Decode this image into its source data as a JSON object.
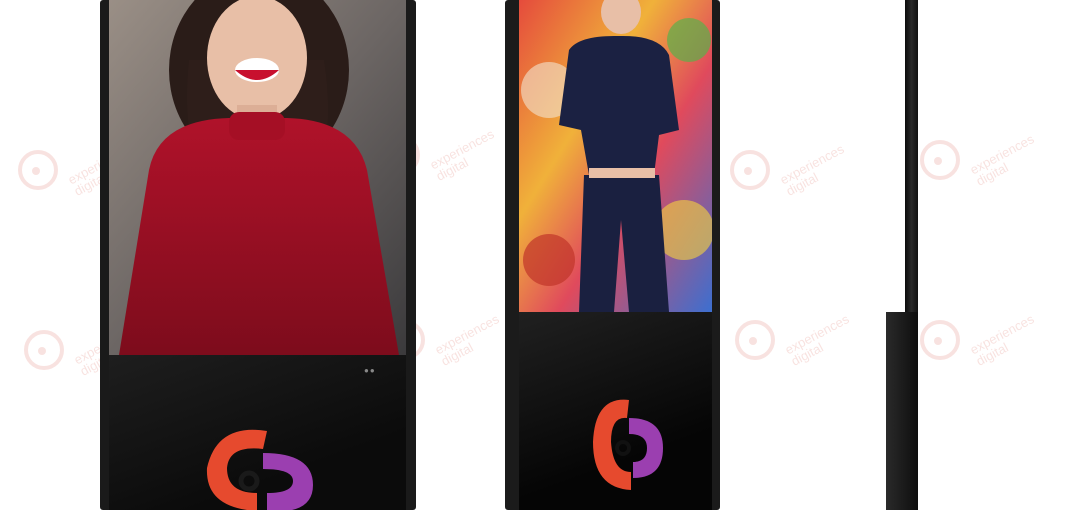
{
  "watermark": {
    "line1": "experiences",
    "line2": "digital"
  },
  "colors": {
    "brand_orange": "#e64a2e",
    "brand_purple": "#9b3fb0",
    "kiosk_body": "#151515"
  },
  "icons": {
    "brand_logo": "ed-logo-icon"
  },
  "kiosks": [
    {
      "label": "front-left",
      "screen_subject": "woman in red top smiling"
    },
    {
      "label": "front-right",
      "screen_subject": "woman in navy outfit before graffiti"
    },
    {
      "label": "side-view"
    }
  ]
}
